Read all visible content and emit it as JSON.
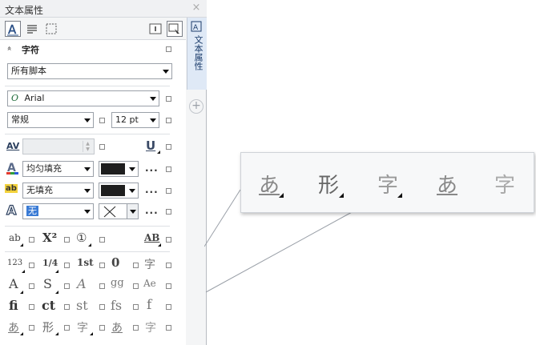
{
  "panel": {
    "title": "文本属性",
    "close_glyph": "×",
    "section_title": "字符",
    "collapse_glyph": "»",
    "script_dropdown": "所有脚本",
    "font_name": "Arial",
    "font_icon": "O",
    "style_dropdown": "常规",
    "size_dropdown": "12 pt",
    "kerning_icon": "AV",
    "underline_icon": "U",
    "fill_label": "均匀填充",
    "bg_fill_label": "无填充",
    "outline_label": "无",
    "fill_color": "#1e1e1e",
    "bg_fill_color": "#1e1e1e",
    "dots": "...",
    "side_tab_label": "文本属性",
    "add_glyph": "+"
  },
  "glyph_rows": [
    [
      "ab",
      "X²",
      "①",
      "AB"
    ],
    [
      "123",
      "1/4",
      "1st",
      "0",
      "字"
    ],
    [
      "A",
      "S",
      "A",
      "gg",
      "Ae"
    ],
    [
      "fi",
      "ct",
      "st",
      "fs",
      "f"
    ],
    [
      "あ",
      "形",
      "字",
      "あ",
      "字"
    ]
  ],
  "zoom_glyphs": [
    "あ",
    "形",
    "字",
    "あ",
    "字"
  ]
}
